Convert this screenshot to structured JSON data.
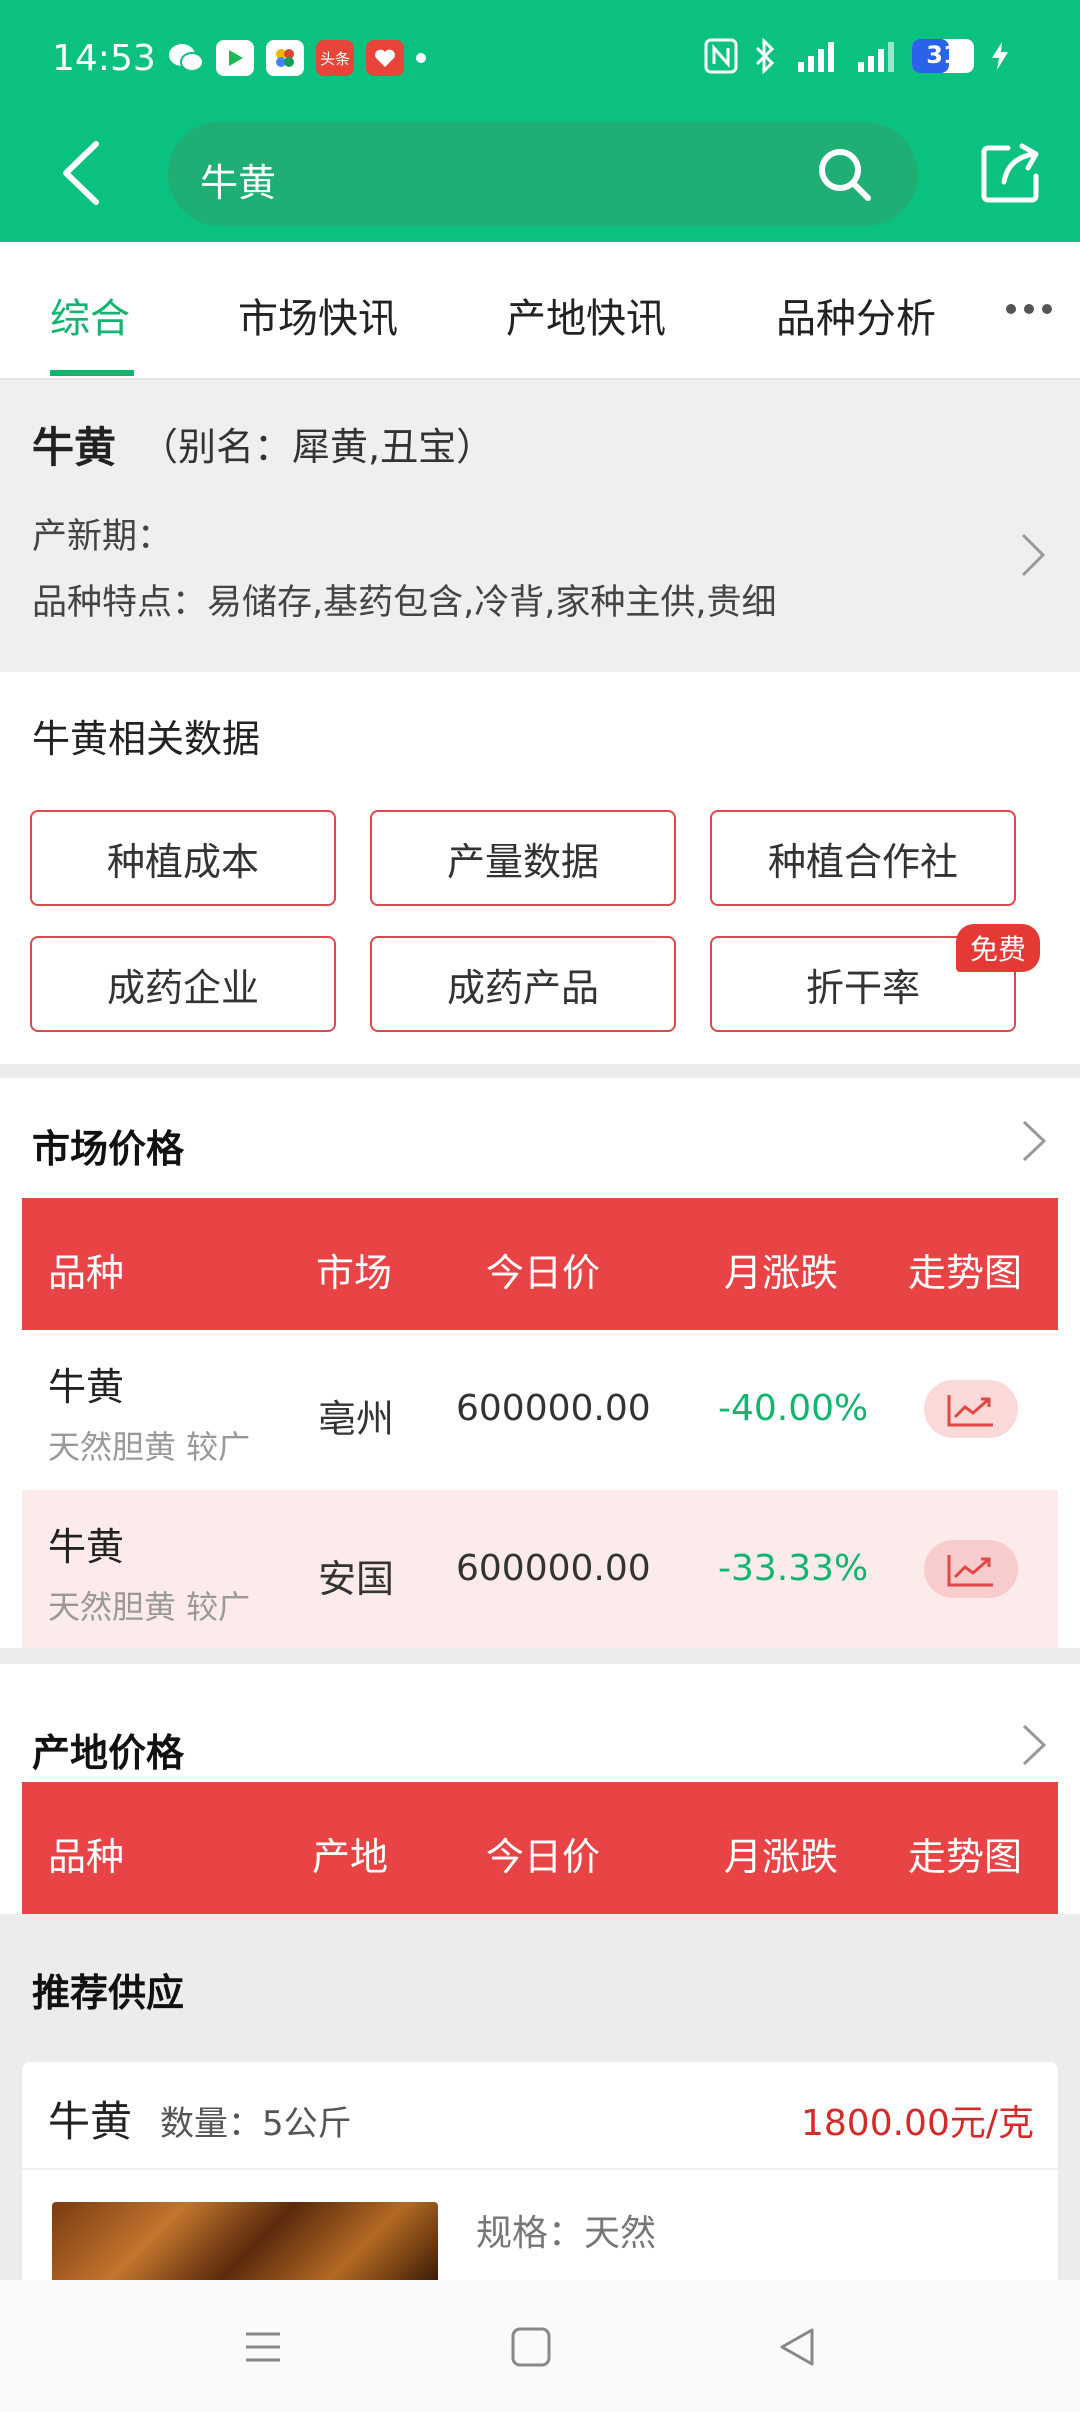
{
  "status_bar": {
    "time": "14:53",
    "battery": "31",
    "app_icons": [
      "wechat-icon",
      "video-app-icon",
      "multi-app-icon",
      "toutiao-icon",
      "health-app-icon"
    ],
    "app_labels": [
      "",
      "",
      "",
      "头条",
      ""
    ]
  },
  "header": {
    "search_text": "牛黄",
    "accent": "#0bc17f"
  },
  "tabs": [
    {
      "label": "综合",
      "active": true
    },
    {
      "label": "市场快讯"
    },
    {
      "label": "产地快讯"
    },
    {
      "label": "品种分析"
    }
  ],
  "herb": {
    "name": "牛黄",
    "alias": "（别名：犀黄,丑宝）",
    "harvest_label": "产新期：",
    "features": "品种特点：易储存,基药包含,冷背,家种主供,贵细"
  },
  "related": {
    "title": "牛黄相关数据",
    "buttons": [
      "种植成本",
      "产量数据",
      "种植合作社",
      "成药企业",
      "成药产品",
      "折干率"
    ],
    "free_badge": "免费"
  },
  "market_price": {
    "title": "市场价格",
    "headers": [
      "品种",
      "市场",
      "今日价",
      "月涨跌",
      "走势图"
    ],
    "rows": [
      {
        "name": "牛黄",
        "spec": "天然胆黄 较广",
        "market": "亳州",
        "price": "600000.00",
        "change": "-40.00%"
      },
      {
        "name": "牛黄",
        "spec": "天然胆黄 较广",
        "market": "安国",
        "price": "600000.00",
        "change": "-33.33%"
      }
    ]
  },
  "origin_price": {
    "title": "产地价格",
    "headers": [
      "品种",
      "产地",
      "今日价",
      "月涨跌",
      "走势图"
    ]
  },
  "recommend": {
    "title": "推荐供应",
    "item": {
      "name": "牛黄",
      "quantity": "数量：5公斤",
      "price": "1800.00元/克",
      "spec": "规格：天然"
    }
  }
}
